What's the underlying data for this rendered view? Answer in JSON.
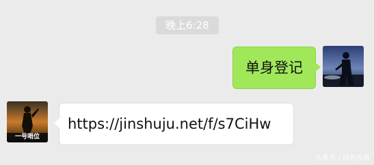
{
  "timestamp": "晚上6:28",
  "messages": [
    {
      "side": "right",
      "text": "单身登记"
    },
    {
      "side": "left",
      "text": "https://jinshuju.net/f/s7CiHw",
      "avatar_caption": "一号哨位"
    }
  ],
  "watermark": "头条号 / 绿色方舟",
  "colors": {
    "background": "#ebebeb",
    "sent_bubble": "#a0e75a",
    "received_bubble": "#ffffff",
    "timestamp_bg": "#dadada"
  }
}
